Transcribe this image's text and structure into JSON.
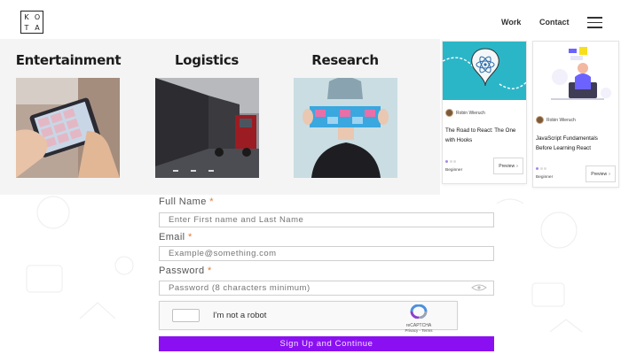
{
  "header": {
    "logo_letters": [
      "K",
      "O",
      "T",
      "A"
    ],
    "nav": [
      {
        "label": "Work"
      },
      {
        "label": "Contact"
      }
    ],
    "menu_icon": "hamburger-menu-icon"
  },
  "categories": [
    {
      "title": "Entertainment"
    },
    {
      "title": "Logistics"
    },
    {
      "title": "Research"
    }
  ],
  "courses": [
    {
      "author": "Robin Wieruch",
      "title": "The Road to React: The One with Hooks",
      "level": "Beginner",
      "preview_label": "Preview",
      "thumb_bg": "#2bb6c8"
    },
    {
      "author": "Robin Wieruch",
      "title": "JavaScript Fundamentals Before Learning React",
      "level": "Beginner",
      "preview_label": "Preview",
      "thumb_bg": "#ffffff"
    }
  ],
  "form": {
    "full_name": {
      "label": "Full Name",
      "required_mark": "*",
      "placeholder": "Enter First name and Last Name"
    },
    "email": {
      "label": "Email",
      "required_mark": "*",
      "placeholder": "Example@something.com"
    },
    "password": {
      "label": "Password",
      "required_mark": "*",
      "placeholder": "Password (8 characters minimum)"
    },
    "captcha": {
      "label": "I'm not a robot",
      "brand": "reCAPTCHA",
      "links": "Privacy - Terms"
    },
    "submit_label": "Sign Up and Continue"
  },
  "colors": {
    "accent": "#8a10f2",
    "required": "#e07d37",
    "panel_bg": "#f4f4f4"
  }
}
